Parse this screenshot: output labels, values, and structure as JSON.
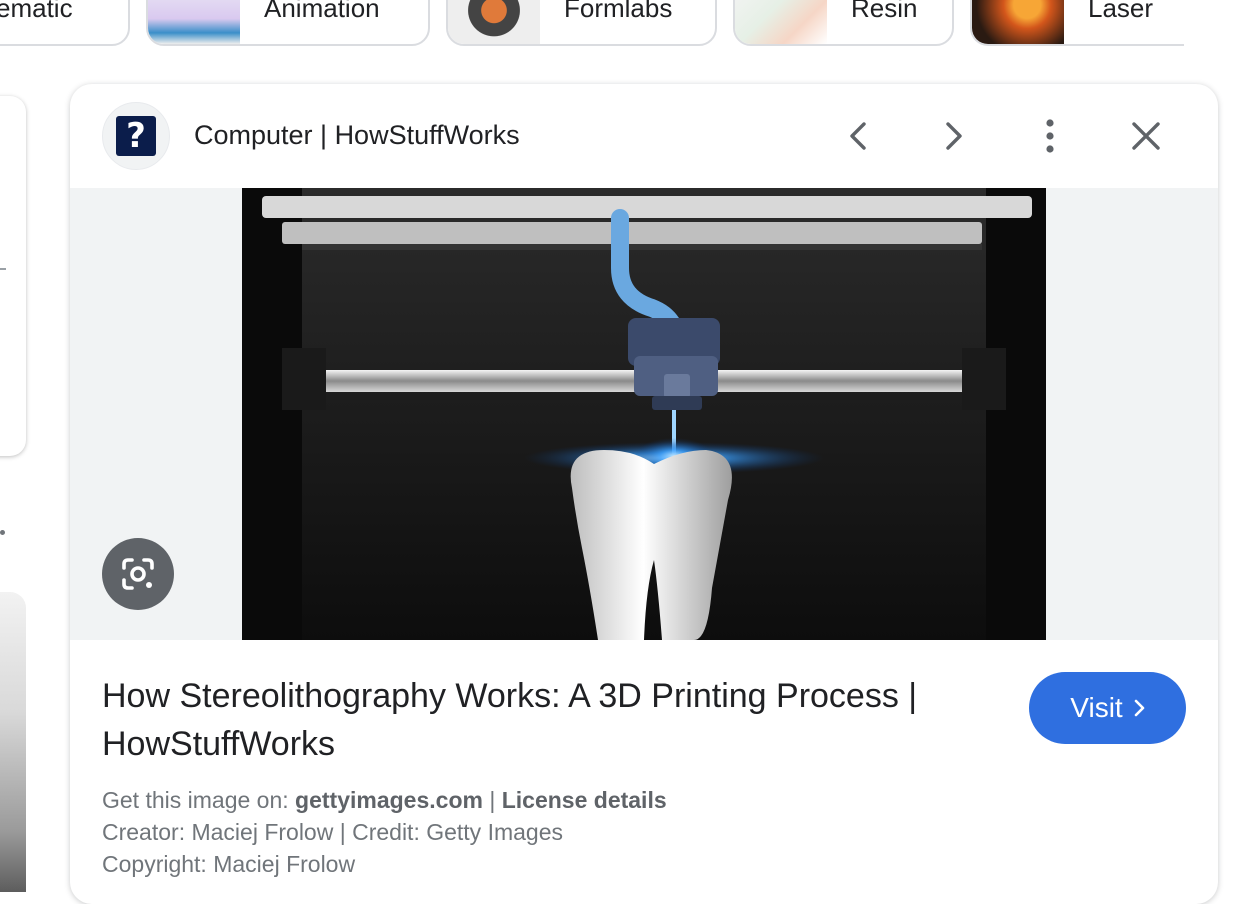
{
  "chips": [
    {
      "label": "ematic"
    },
    {
      "label": "Animation"
    },
    {
      "label": "Formlabs"
    },
    {
      "label": "Resin"
    },
    {
      "label": "Laser"
    }
  ],
  "panel": {
    "site_name": "Computer | HowStuffWorks",
    "logo_glyph": "?",
    "title": "How Stereolithography Works: A 3D Printing Process | HowStuffWorks",
    "visit_label": "Visit",
    "meta": {
      "get_prefix": "Get this image on: ",
      "source": "gettyimages.com",
      "separator": " | ",
      "license": "License details",
      "creator_line": "Creator: Maciej Frolow | Credit: Getty Images",
      "copyright_line": "Copyright: Maciej Frolow"
    }
  },
  "icons": {
    "prev": "chevron-left-icon",
    "next": "chevron-right-icon",
    "more": "more-vert-icon",
    "close": "close-icon",
    "lens": "google-lens-icon"
  },
  "colors": {
    "accent": "#2f6fe0",
    "lens_bg": "#5f6368",
    "image_bg": "#f1f3f4"
  }
}
